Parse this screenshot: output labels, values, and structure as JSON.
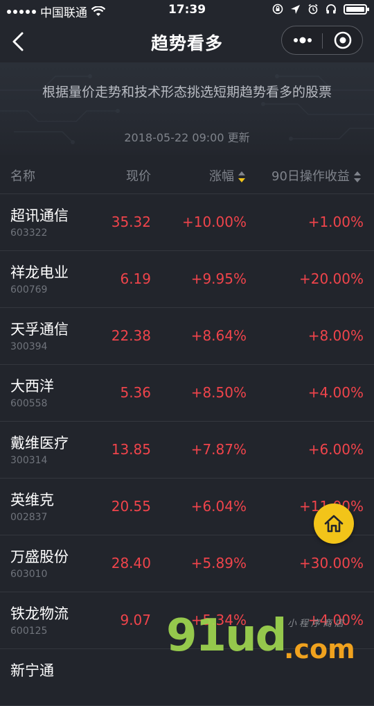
{
  "status_bar": {
    "carrier": "中国联通",
    "time": "17:39"
  },
  "nav": {
    "title": "趋势看多"
  },
  "banner": {
    "description": "根据量价走势和技术形态挑选短期趋势看多的股票",
    "updated": "2018-05-22 09:00 更新"
  },
  "table": {
    "headers": {
      "name": "名称",
      "price": "现价",
      "change": "涨幅",
      "return90": "90日操作收益"
    },
    "rows": [
      {
        "name": "超讯通信",
        "code": "603322",
        "price": "35.32",
        "change": "+10.00%",
        "ret": "+1.00%"
      },
      {
        "name": "祥龙电业",
        "code": "600769",
        "price": "6.19",
        "change": "+9.95%",
        "ret": "+20.00%"
      },
      {
        "name": "天孚通信",
        "code": "300394",
        "price": "22.38",
        "change": "+8.64%",
        "ret": "+8.00%"
      },
      {
        "name": "大西洋",
        "code": "600558",
        "price": "5.36",
        "change": "+8.50%",
        "ret": "+4.00%"
      },
      {
        "name": "戴维医疗",
        "code": "300314",
        "price": "13.85",
        "change": "+7.87%",
        "ret": "+6.00%"
      },
      {
        "name": "英维克",
        "code": "002837",
        "price": "20.55",
        "change": "+6.04%",
        "ret": "+11.00%"
      },
      {
        "name": "万盛股份",
        "code": "603010",
        "price": "28.40",
        "change": "+5.89%",
        "ret": "+30.00%"
      },
      {
        "name": "铁龙物流",
        "code": "600125",
        "price": "9.07",
        "change": "+5.34%",
        "ret": "+4.00%"
      },
      {
        "name": "新宁通",
        "code": "",
        "price": "",
        "change": "",
        "ret": ""
      }
    ]
  },
  "watermark": {
    "main": "91ud",
    "domain": ".com",
    "sub": "小程序商店"
  },
  "icons": {
    "home": "home-icon",
    "back": "chevron-left-icon",
    "more": "more-dots-icon",
    "close": "target-close-icon"
  },
  "colors": {
    "background": "#22252c",
    "rise": "#f0444b",
    "accent": "#f2c419",
    "muted": "#7f838b"
  }
}
